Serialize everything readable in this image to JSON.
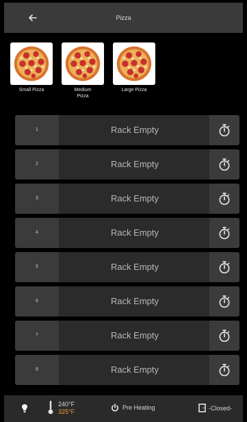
{
  "header": {
    "title": "Pizza",
    "back_icon": "arrow-left-icon"
  },
  "pizzas": [
    {
      "label": "Small Pizza",
      "icon": "pizza-icon"
    },
    {
      "label": "Medium Pizza",
      "icon": "pizza-icon"
    },
    {
      "label": "Large Pizza",
      "icon": "pizza-icon"
    }
  ],
  "racks": [
    {
      "number": "1",
      "status": "Rack Empty",
      "icon": "stopwatch-icon"
    },
    {
      "number": "2",
      "status": "Rack Empty",
      "icon": "stopwatch-icon"
    },
    {
      "number": "3",
      "status": "Rack Empty",
      "icon": "stopwatch-icon"
    },
    {
      "number": "4",
      "status": "Rack Empty",
      "icon": "stopwatch-icon"
    },
    {
      "number": "5",
      "status": "Rack Empty",
      "icon": "stopwatch-icon"
    },
    {
      "number": "6",
      "status": "Rack Empty",
      "icon": "stopwatch-icon"
    },
    {
      "number": "7",
      "status": "Rack Empty",
      "icon": "stopwatch-icon"
    },
    {
      "number": "8",
      "status": "Rack Empty",
      "icon": "stopwatch-icon"
    }
  ],
  "footer": {
    "light_icon": "bulb-icon",
    "thermometer_icon": "thermometer-icon",
    "current_temp": "240°F",
    "target_temp": "325°F",
    "power_icon": "power-icon",
    "status": "Pre Heating",
    "door_icon": "door-icon",
    "door_status": "-Closed-"
  },
  "colors": {
    "background": "#000000",
    "header": "#3a3a3a",
    "rack_body": "#2b2b2b",
    "rack_cap": "#3b3b3b",
    "target_temp": "#e8a23c"
  }
}
